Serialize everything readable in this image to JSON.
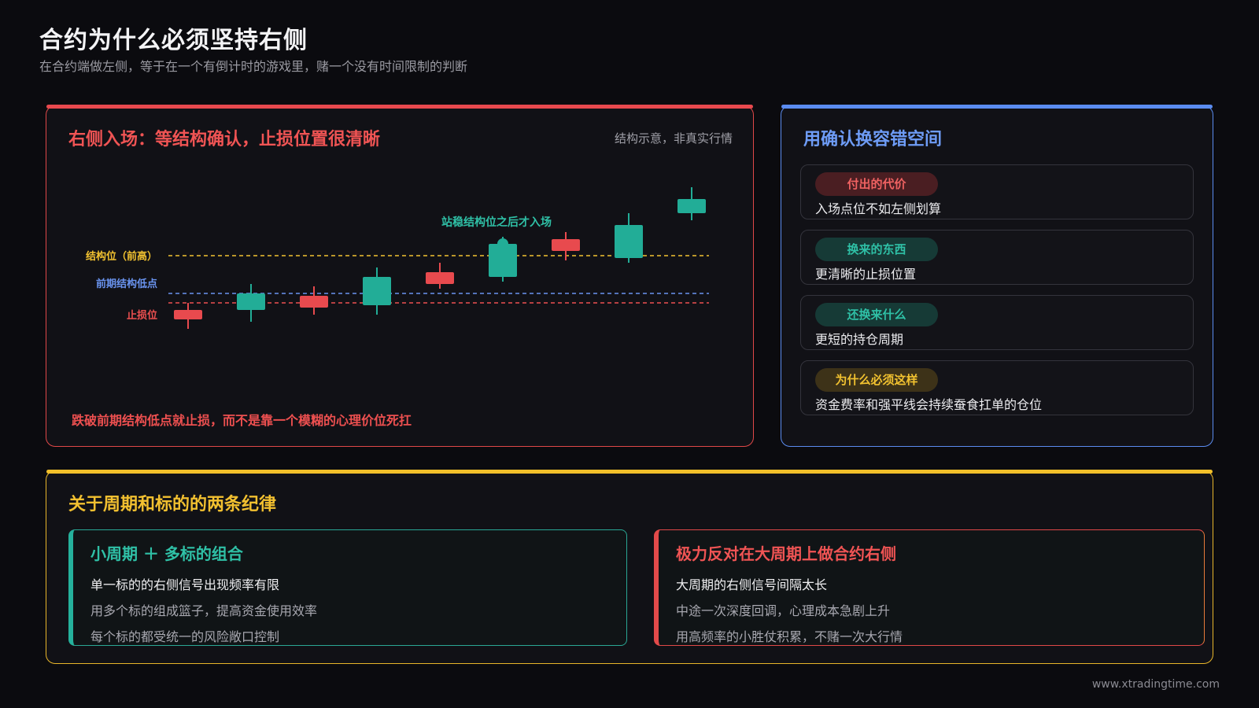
{
  "header": {
    "title": "合约为什么必须坚持右侧",
    "subtitle": "在合约端做左侧，等于在一个有倒计时的游戏里，赌一个没有时间限制的判断"
  },
  "chart_card": {
    "title": "右侧入场：等结构确认，止损位置很清晰",
    "note": "结构示意，非真实行情",
    "annotation": "站稳结构位之后才入场",
    "footnote": "跌破前期结构低点就止损，而不是靠一个模糊的心理价位死扛"
  },
  "chart_data": {
    "type": "candlestick",
    "levels": [
      {
        "name": "结构位（前高）",
        "value": 0.6,
        "color": "#f2c230"
      },
      {
        "name": "前期结构低点",
        "value": 0.44,
        "color": "#6a94f0"
      },
      {
        "name": "止损位",
        "value": 0.4,
        "color": "#ee5050"
      }
    ],
    "candles": [
      {
        "open": 0.37,
        "close": 0.33,
        "high": 0.4,
        "low": 0.29,
        "dir": "down"
      },
      {
        "open": 0.37,
        "close": 0.44,
        "high": 0.48,
        "low": 0.32,
        "dir": "up"
      },
      {
        "open": 0.43,
        "close": 0.38,
        "high": 0.47,
        "low": 0.35,
        "dir": "down"
      },
      {
        "open": 0.39,
        "close": 0.51,
        "high": 0.55,
        "low": 0.35,
        "dir": "up"
      },
      {
        "open": 0.53,
        "close": 0.48,
        "high": 0.57,
        "low": 0.46,
        "dir": "down"
      },
      {
        "open": 0.51,
        "close": 0.65,
        "high": 0.68,
        "low": 0.49,
        "dir": "up"
      },
      {
        "open": 0.67,
        "close": 0.62,
        "high": 0.7,
        "low": 0.58,
        "dir": "down"
      },
      {
        "open": 0.59,
        "close": 0.73,
        "high": 0.78,
        "low": 0.57,
        "dir": "up"
      },
      {
        "open": 0.78,
        "close": 0.84,
        "high": 0.89,
        "low": 0.75,
        "dir": "up"
      }
    ],
    "colors": {
      "up": "#22ad97",
      "down": "#e84a4e"
    }
  },
  "confirm_card": {
    "title": "用确认换容错空间",
    "items": [
      {
        "tag": "付出的代价",
        "desc": "入场点位不如左侧划算"
      },
      {
        "tag": "换来的东西",
        "desc": "更清晰的止损位置"
      },
      {
        "tag": "还换来什么",
        "desc": "更短的持仓周期"
      },
      {
        "tag": "为什么必须这样",
        "desc": "资金费率和强平线会持续蚕食扛单的仓位"
      }
    ]
  },
  "rules_card": {
    "title": "关于周期和标的的两条纪律",
    "left": {
      "heading": "小周期 ＋ 多标的组合",
      "lines": [
        "单一标的的右侧信号出现频率有限",
        "用多个标的组成篮子，提高资金使用效率",
        "每个标的都受统一的风险敞口控制"
      ]
    },
    "right": {
      "heading": "极力反对在大周期上做合约右侧",
      "lines": [
        "大周期的右侧信号间隔太长",
        "中途一次深度回调，心理成本急剧上升",
        "用高频率的小胜仗积累，不赌一次大行情"
      ]
    }
  },
  "footer": {
    "url": "www.xtradingtime.com"
  }
}
